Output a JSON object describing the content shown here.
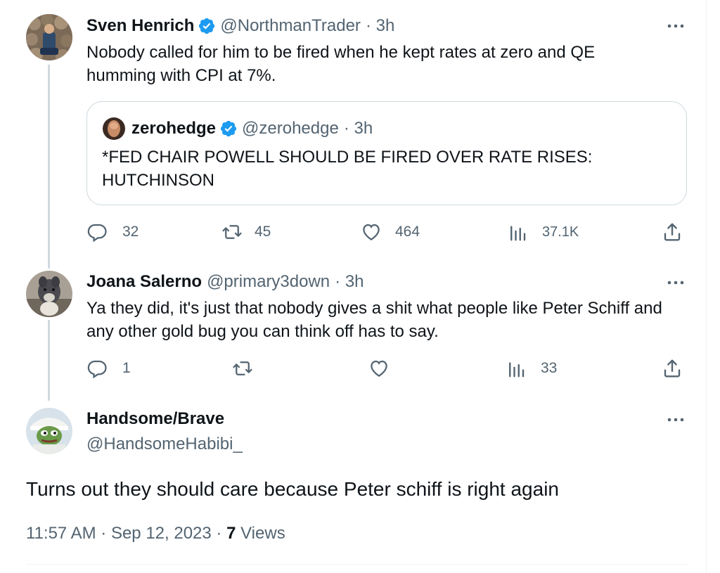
{
  "tweet1": {
    "name": "Sven Henrich",
    "handle": "@NorthmanTrader",
    "time": "· 3h",
    "text": "Nobody called for him to be fired when he kept rates at zero and QE humming with CPI at 7%.",
    "quote": {
      "name": "zerohedge",
      "handle": "@zerohedge",
      "time": "· 3h",
      "text": "*FED CHAIR POWELL SHOULD BE FIRED OVER RATE RISES: HUTCHINSON"
    },
    "replies": "32",
    "retweets": "45",
    "likes": "464",
    "views": "37.1K"
  },
  "tweet2": {
    "name": "Joana Salerno",
    "handle": "@primary3down",
    "time": "· 3h",
    "text": "Ya they did, it's just that nobody gives a shit what people like Peter Schiff and any other gold bug you can think off has to say.",
    "replies": "1",
    "views": "33"
  },
  "main": {
    "name": "Handsome/Brave",
    "handle": "@HandsomeHabibi_",
    "text": "Turns out they should care because Peter schiff is right again",
    "time": "11:57 AM · Sep 12, 2023 · ",
    "views_count": "7",
    "views_label": " Views"
  },
  "icons": {
    "verified": "verified-badge-icon",
    "more": "more-horizontal-icon",
    "reply": "reply-icon",
    "retweet": "retweet-icon",
    "like": "heart-icon",
    "views": "analytics-icon",
    "share": "share-icon"
  },
  "colors": {
    "verified": "#1d9bf0",
    "secondary_text": "#536471",
    "thread_line": "#cfd9de"
  }
}
